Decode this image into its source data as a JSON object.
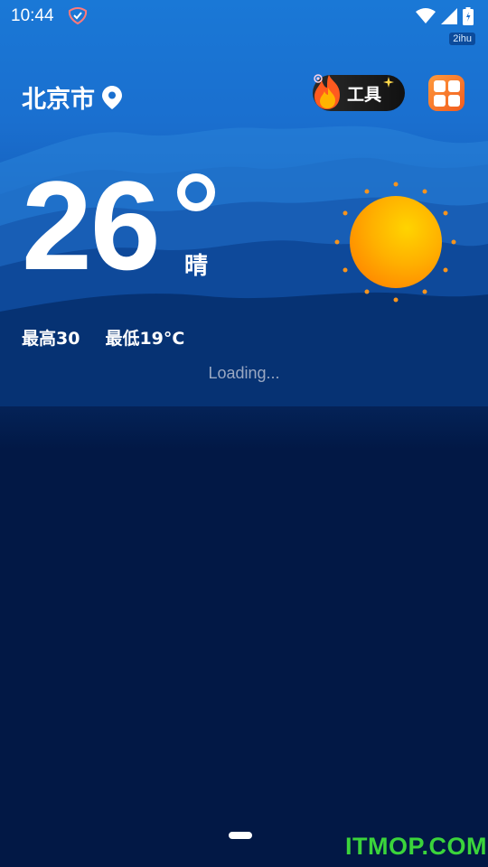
{
  "status_bar": {
    "time": "10:44",
    "badge": "2ihu"
  },
  "header": {
    "city": "北京市",
    "tools_label": "工具"
  },
  "weather": {
    "temperature": "26",
    "condition": "晴",
    "high": "最高30",
    "low": "最低19°C"
  },
  "main": {
    "loading_text": "Loading..."
  },
  "watermark": "ITMOP.COM",
  "colors": {
    "sky_top": "#1a78d6",
    "background": "#021845",
    "sun": "#ffb400",
    "sun_rays": "#f7941d",
    "apps_button": "#f15b1e",
    "watermark": "#3bd43b"
  },
  "icons": {
    "location": "map-pin-icon",
    "tools": "fire-icon",
    "apps": "grid-icon",
    "weather": "sun-icon",
    "wifi": "wifi-icon",
    "signal": "signal-icon",
    "battery": "battery-icon"
  }
}
